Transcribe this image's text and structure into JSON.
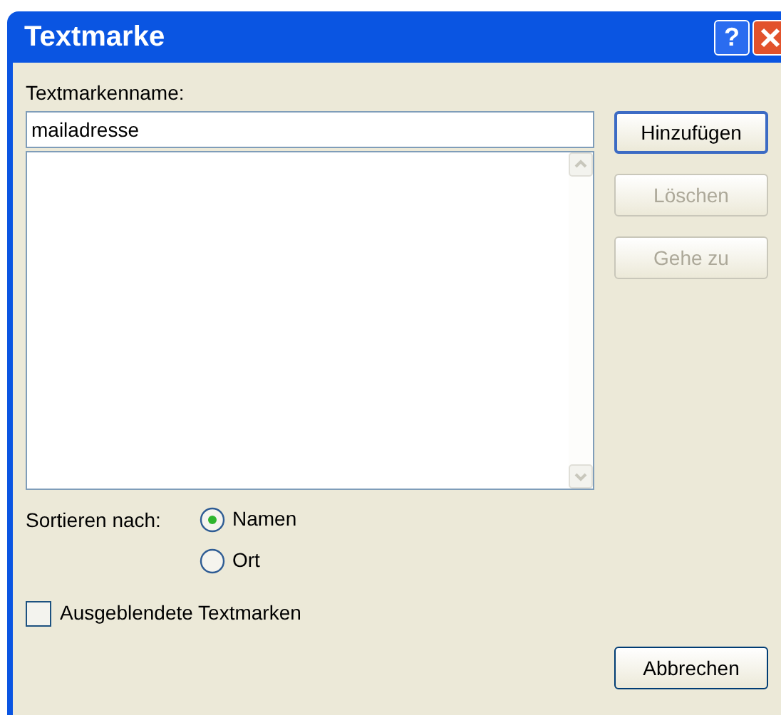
{
  "window": {
    "title": "Textmarke",
    "title_buttons": [
      {
        "kind": "help",
        "label": "?"
      },
      {
        "kind": "close"
      }
    ]
  },
  "name_field": {
    "label": "Textmarkenname:",
    "value": "mailadresse"
  },
  "buttons": [
    {
      "label": "Hinzufügen",
      "disabled": false,
      "default": true
    },
    {
      "label": "Löschen",
      "disabled": true,
      "default": false
    },
    {
      "label": "Gehe zu",
      "disabled": true,
      "default": false
    }
  ],
  "sort": {
    "label": "Sortieren nach:",
    "options": [
      {
        "label": "Namen",
        "selected": true
      },
      {
        "label": "Ort",
        "selected": false
      }
    ]
  },
  "hidden_bookmarks": {
    "label": "Ausgeblendete Textmarken",
    "checked": false
  },
  "cancel_button": {
    "label": "Abbrechen"
  }
}
